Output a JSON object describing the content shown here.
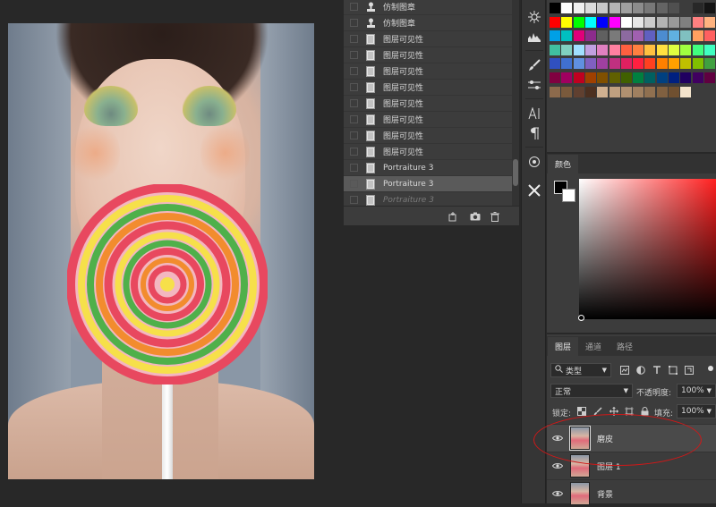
{
  "history": {
    "items": [
      {
        "label": "仿制图章",
        "icon": "clone-stamp-icon"
      },
      {
        "label": "仿制图章",
        "icon": "clone-stamp-icon"
      },
      {
        "label": "图层可见性",
        "icon": "document-state-icon"
      },
      {
        "label": "图层可见性",
        "icon": "document-state-icon"
      },
      {
        "label": "图层可见性",
        "icon": "document-state-icon"
      },
      {
        "label": "图层可见性",
        "icon": "document-state-icon"
      },
      {
        "label": "图层可见性",
        "icon": "document-state-icon"
      },
      {
        "label": "图层可见性",
        "icon": "document-state-icon"
      },
      {
        "label": "图层可见性",
        "icon": "document-state-icon"
      },
      {
        "label": "图层可见性",
        "icon": "document-state-icon"
      },
      {
        "label": "Portraiture 3",
        "icon": "document-state-icon"
      },
      {
        "label": "Portraiture 3",
        "icon": "document-state-icon",
        "selected": true
      },
      {
        "label": "Portraiture 3",
        "icon": "document-state-icon",
        "greyed": true
      }
    ],
    "footer": {
      "new_document_icon": "new-document-from-state-icon",
      "snapshot_icon": "camera-icon",
      "delete_icon": "trash-icon"
    }
  },
  "toolstrip": {
    "tools": [
      "brush-settings-icon",
      "histogram-icon",
      "brush-icon",
      "adjustments-icon",
      "character-icon",
      "paragraph-icon",
      "navigator-icon",
      "tools-icon"
    ]
  },
  "swatches": {
    "rows": [
      [
        "#000000",
        "#ffffff",
        "#f0f0f0",
        "#dcdcdc",
        "#c8c8c8",
        "#b4b4b4",
        "#a0a0a0",
        "#8c8c8c",
        "#787878",
        "#646464",
        "#505050",
        "#3c3c3c",
        "#282828",
        "#141414"
      ],
      [
        "#ff0000",
        "#ffff00",
        "#00ff00",
        "#00ffff",
        "#0000ff",
        "#ff00ff",
        "#ffffff",
        "#e6e6e6",
        "#cccccc",
        "#b3b3b3",
        "#999999",
        "#808080",
        "#ff8080",
        "#ffb380"
      ],
      [
        "#00a0e6",
        "#00c0c0",
        "#e0007a",
        "#8c2c8c",
        "#606060",
        "#7a7a7a",
        "#8c6aa0",
        "#a060b0",
        "#6060c0",
        "#4c8cd0",
        "#60b0e0",
        "#80c0c0",
        "#ffa060",
        "#ff6060"
      ],
      [
        "#40c0a0",
        "#80d0c0",
        "#a0e0ff",
        "#c0a0e0",
        "#e080c0",
        "#ff80a0",
        "#ff6040",
        "#ff8040",
        "#ffc040",
        "#ffe040",
        "#e0ff40",
        "#a0ff40",
        "#40ff80",
        "#40ffc0"
      ],
      [
        "#3050c0",
        "#4070d0",
        "#6090e0",
        "#8060c0",
        "#a040a0",
        "#c03080",
        "#e02060",
        "#ff2040",
        "#ff4020",
        "#ff8000",
        "#ffa000",
        "#c0c000",
        "#80c000",
        "#40a040"
      ],
      [
        "#800040",
        "#a00060",
        "#c00020",
        "#a04000",
        "#805000",
        "#606000",
        "#406000",
        "#008040",
        "#006060",
        "#004080",
        "#002080",
        "#200060",
        "#400060",
        "#600040"
      ],
      [
        "#8c6a4c",
        "#7a5a3c",
        "#604030",
        "#4c3020",
        "#d0b090",
        "#c0a080",
        "#b09070",
        "#a08060",
        "#907050",
        "#806040",
        "#705030",
        "#f4e4cc"
      ]
    ]
  },
  "color_panel": {
    "tab_label": "颜色",
    "foreground": "#000000",
    "background": "#ffffff"
  },
  "layers_panel": {
    "tabs": [
      "图层",
      "通道",
      "路径"
    ],
    "active_tab": "图层",
    "filter_kind": "类型",
    "blend_mode": "正常",
    "opacity_label": "不透明度:",
    "opacity_value": "100%",
    "lock_label": "锁定:",
    "fill_label": "填充:",
    "fill_value": "100%",
    "layers": [
      {
        "name": "磨皮",
        "visible": true,
        "selected": true
      },
      {
        "name": "图层 1",
        "visible": true,
        "selected": false
      },
      {
        "name": "背景",
        "visible": true,
        "selected": false
      }
    ]
  },
  "annotation": {
    "color": "#d01818"
  }
}
